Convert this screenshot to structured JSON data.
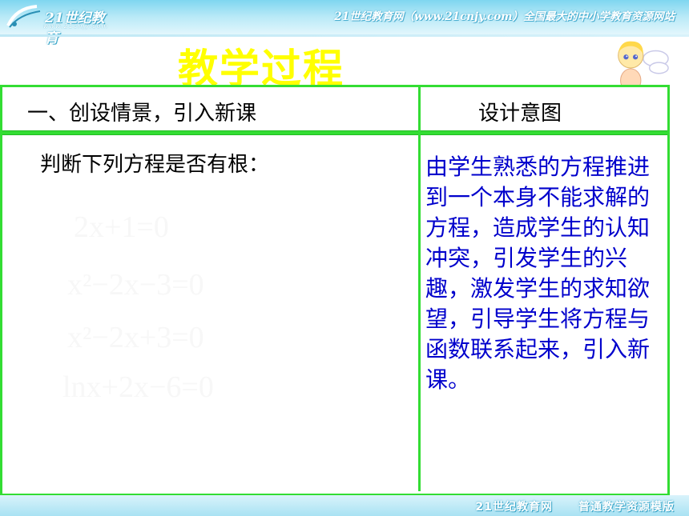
{
  "banner": {
    "logo_main": "21世纪教育",
    "logo_url": "www.21cnjy.com",
    "tagline": "21世纪教育网（www.21cnjy.com）全国最大的中小学教育资源网站"
  },
  "slide": {
    "title": "教学过程"
  },
  "table": {
    "header_left": "一、创设情景，引入新课",
    "header_right": "设计意图",
    "prompt": "判断下列方程是否有根：",
    "equations": [
      "2x+1=0",
      "x²−2x−3=0",
      "x²−2x+3=0",
      "lnx+2x−6=0"
    ],
    "intent_text": "由学生熟悉的方程推进到一个本身不能求解的方程，造成学生的认知冲突，引发学生的兴趣，激发学生的求知欲望，引导学生将方程与函数联系起来，引入新课。"
  },
  "footer": {
    "left": "21世纪教育网",
    "right": "普通教学资源模版"
  },
  "colors": {
    "title": "#ffff00",
    "table_border": "#33dd33",
    "intent_text": "#0000cc",
    "banner": "#7fd6f0"
  },
  "icons": [
    "logo-swoosh-icon",
    "angel-icon"
  ]
}
